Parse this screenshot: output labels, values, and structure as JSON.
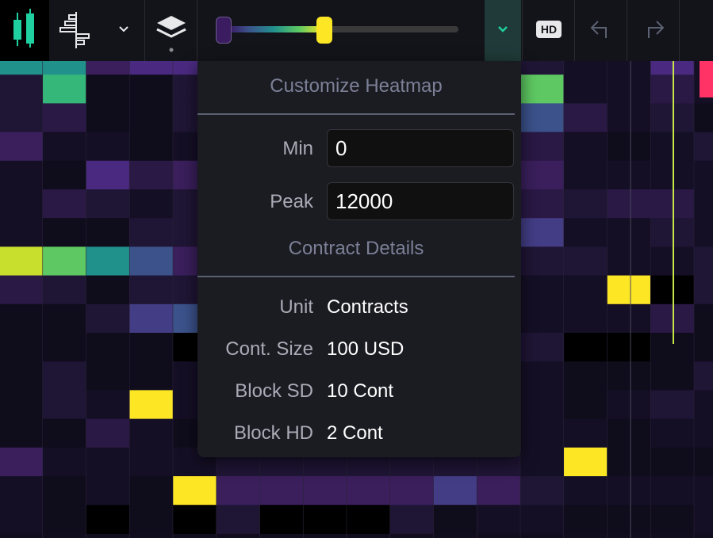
{
  "toolbar": {
    "icons": {
      "chart_type": "candlestick-icon",
      "heatmap_type": "depth-profile-icon",
      "dropdown": "chevron-down-icon",
      "layers": "layers-icon",
      "collapse": "chevron-down-icon",
      "undo": "undo-icon",
      "redo": "redo-icon"
    },
    "hd_label": "HD",
    "slider": {
      "min_fraction": 0.0,
      "peak_fraction": 0.43,
      "gradient": [
        "#3a0c59",
        "#3b528b",
        "#21918c",
        "#5ec962",
        "#fde725"
      ]
    }
  },
  "popup": {
    "title": "Customize Heatmap",
    "min_label": "Min",
    "min_value": "0",
    "peak_label": "Peak",
    "peak_value": "12000",
    "details_title": "Contract Details",
    "details": [
      {
        "label": "Unit",
        "value": "Contracts"
      },
      {
        "label": "Cont. Size",
        "value": "100 USD"
      },
      {
        "label": "Block SD",
        "value": "10 Cont"
      },
      {
        "label": "Block HD",
        "value": "2 Cont"
      }
    ]
  },
  "colors": {
    "accent": "#1fd0a0",
    "price_line": "#c8e84a",
    "peak": "#fde725",
    "highlight": "#ff3366"
  },
  "heatmap": {
    "palette": [
      "#000000",
      "#0f0c1c",
      "#150f26",
      "#1f1535",
      "#2a1845",
      "#3a1f5c",
      "#4a2a80",
      "#433d86",
      "#3b528b",
      "#21918c",
      "#35b779",
      "#5ec962",
      "#c8df2e",
      "#fde725"
    ],
    "rows": [
      [
        9,
        9,
        5,
        6,
        6,
        3,
        3,
        3,
        3,
        3,
        3,
        3,
        3,
        2,
        2,
        6,
        2
      ],
      [
        3,
        10,
        1,
        1,
        3,
        3,
        3,
        3,
        3,
        3,
        3,
        3,
        11,
        2,
        2,
        4,
        2
      ],
      [
        3,
        4,
        1,
        1,
        3,
        3,
        3,
        3,
        3,
        3,
        3,
        3,
        8,
        4,
        2,
        3,
        1
      ],
      [
        5,
        2,
        2,
        1,
        2,
        3,
        3,
        3,
        3,
        3,
        3,
        3,
        4,
        2,
        1,
        2,
        3
      ],
      [
        2,
        1,
        6,
        4,
        5,
        3,
        3,
        3,
        3,
        3,
        3,
        3,
        5,
        2,
        2,
        2,
        2
      ],
      [
        2,
        4,
        3,
        2,
        3,
        3,
        3,
        3,
        3,
        3,
        3,
        3,
        4,
        3,
        4,
        4,
        2
      ],
      [
        2,
        1,
        1,
        3,
        3,
        3,
        3,
        3,
        3,
        3,
        3,
        3,
        7,
        2,
        2,
        3,
        2
      ],
      [
        12,
        11,
        9,
        8,
        5,
        3,
        3,
        3,
        3,
        3,
        3,
        3,
        3,
        3,
        2,
        2,
        3
      ],
      [
        4,
        3,
        1,
        3,
        3,
        3,
        3,
        3,
        3,
        3,
        3,
        3,
        2,
        2,
        13,
        0,
        3
      ],
      [
        1,
        1,
        3,
        7,
        8,
        3,
        3,
        3,
        3,
        3,
        3,
        3,
        2,
        2,
        2,
        4,
        1
      ],
      [
        1,
        1,
        1,
        1,
        0,
        3,
        3,
        3,
        3,
        3,
        3,
        3,
        3,
        0,
        0,
        1,
        1
      ],
      [
        1,
        3,
        1,
        1,
        2,
        3,
        3,
        3,
        3,
        3,
        3,
        3,
        2,
        1,
        1,
        1,
        3
      ],
      [
        1,
        3,
        2,
        13,
        2,
        3,
        3,
        3,
        3,
        3,
        3,
        3,
        2,
        1,
        2,
        3,
        2
      ],
      [
        1,
        1,
        4,
        2,
        1,
        3,
        3,
        3,
        3,
        3,
        3,
        3,
        2,
        2,
        1,
        2,
        2
      ],
      [
        5,
        2,
        2,
        2,
        2,
        3,
        3,
        3,
        3,
        3,
        3,
        3,
        2,
        13,
        1,
        1,
        1
      ],
      [
        2,
        1,
        2,
        1,
        13,
        5,
        5,
        5,
        5,
        5,
        7,
        5,
        3,
        2,
        2,
        2,
        2
      ],
      [
        2,
        1,
        0,
        1,
        0,
        3,
        0,
        0,
        0,
        3,
        1,
        2,
        2,
        1,
        1,
        1,
        2
      ]
    ]
  }
}
